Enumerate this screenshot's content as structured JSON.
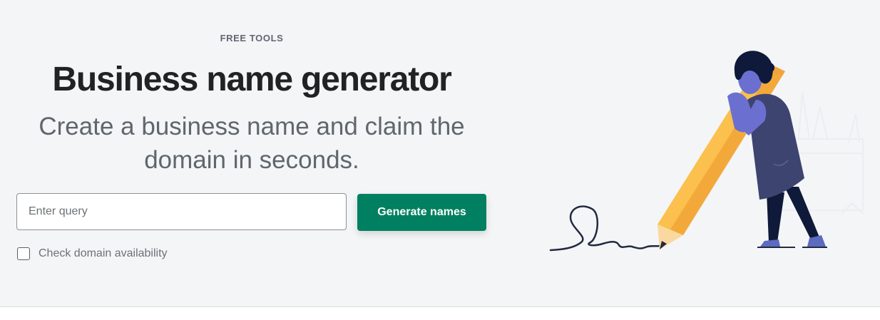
{
  "hero": {
    "eyebrow": "FREE TOOLS",
    "title": "Business name generator",
    "subtitle": "Create a business name and claim the domain in seconds."
  },
  "search": {
    "placeholder": "Enter query",
    "value": "",
    "button_label": "Generate names"
  },
  "domain_check": {
    "label": "Check domain availability",
    "checked": false
  },
  "colors": {
    "background": "#f4f5f7",
    "accent": "#008060",
    "title": "#202223",
    "subtitle": "#5f666d"
  },
  "illustration": {
    "description_icon": "person-with-giant-pencil-illustration"
  }
}
